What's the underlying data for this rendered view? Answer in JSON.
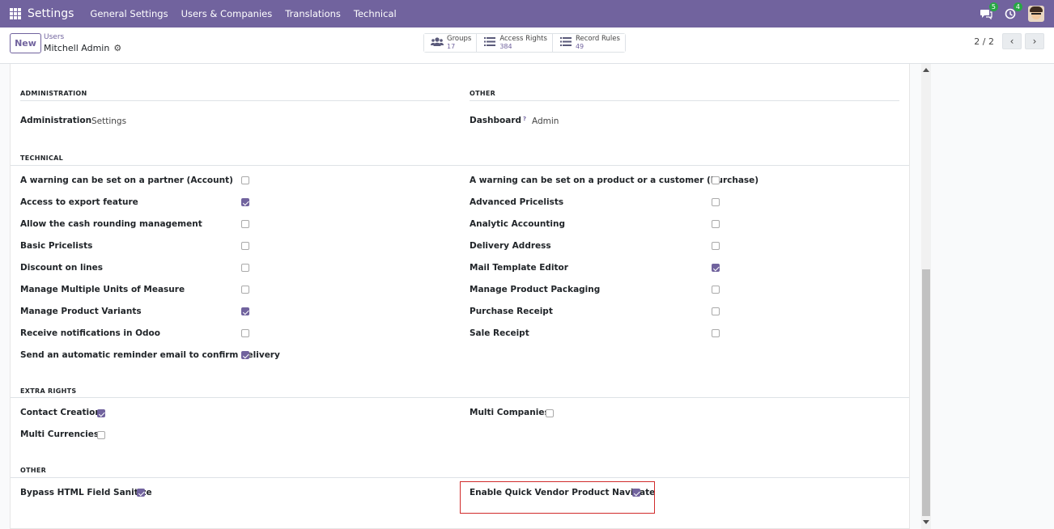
{
  "navbar": {
    "app_title": "Settings",
    "menu": [
      "General Settings",
      "Users & Companies",
      "Translations",
      "Technical"
    ],
    "messages_badge": "5",
    "activities_badge": "4"
  },
  "control": {
    "new_label": "New",
    "breadcrumb": "Users",
    "record_name": "Mitchell Admin",
    "smart_buttons": [
      {
        "label": "Groups",
        "value": "17",
        "icon": "users-icon"
      },
      {
        "label": "Access Rights",
        "value": "384",
        "icon": "list-icon"
      },
      {
        "label": "Record Rules",
        "value": "49",
        "icon": "list-icon"
      }
    ],
    "pager": "2 / 2"
  },
  "sections": {
    "administration": {
      "title": "ADMINISTRATION",
      "field_label": "Administration",
      "field_value": "Settings"
    },
    "other_top": {
      "title": "OTHER",
      "field_label": "Dashboard",
      "help": "?",
      "field_value": "Admin"
    },
    "technical": {
      "title": "TECHNICAL",
      "left": [
        {
          "label": "A warning can be set on a partner (Account)",
          "checked": false
        },
        {
          "label": "Access to export feature",
          "checked": true
        },
        {
          "label": "Allow the cash rounding management",
          "checked": false
        },
        {
          "label": "Basic Pricelists",
          "checked": false
        },
        {
          "label": "Discount on lines",
          "checked": false
        },
        {
          "label": "Manage Multiple Units of Measure",
          "checked": false
        },
        {
          "label": "Manage Product Variants",
          "checked": true
        },
        {
          "label": "Receive notifications in Odoo",
          "checked": false
        },
        {
          "label": "Send an automatic reminder email to confirm delivery",
          "checked": true
        }
      ],
      "right": [
        {
          "label": "A warning can be set on a product or a customer (Purchase)",
          "checked": false
        },
        {
          "label": "Advanced Pricelists",
          "checked": false
        },
        {
          "label": "Analytic Accounting",
          "checked": false
        },
        {
          "label": "Delivery Address",
          "checked": false
        },
        {
          "label": "Mail Template Editor",
          "checked": true
        },
        {
          "label": "Manage Product Packaging",
          "checked": false
        },
        {
          "label": "Purchase Receipt",
          "checked": false
        },
        {
          "label": "Sale Receipt",
          "checked": false
        }
      ]
    },
    "extra_rights": {
      "title": "EXTRA RIGHTS",
      "left": [
        {
          "label": "Contact Creation",
          "checked": true
        },
        {
          "label": "Multi Currencies",
          "checked": false
        }
      ],
      "right": [
        {
          "label": "Multi Companies",
          "checked": false
        }
      ]
    },
    "other_bottom": {
      "title": "OTHER",
      "left": [
        {
          "label": "Bypass HTML Field Sanitize",
          "checked": true
        }
      ],
      "right": [
        {
          "label": "Enable Quick Vendor Product Navigate",
          "checked": true
        }
      ]
    }
  },
  "colors": {
    "brand": "#71639e",
    "highlight": "#d12b2b"
  }
}
